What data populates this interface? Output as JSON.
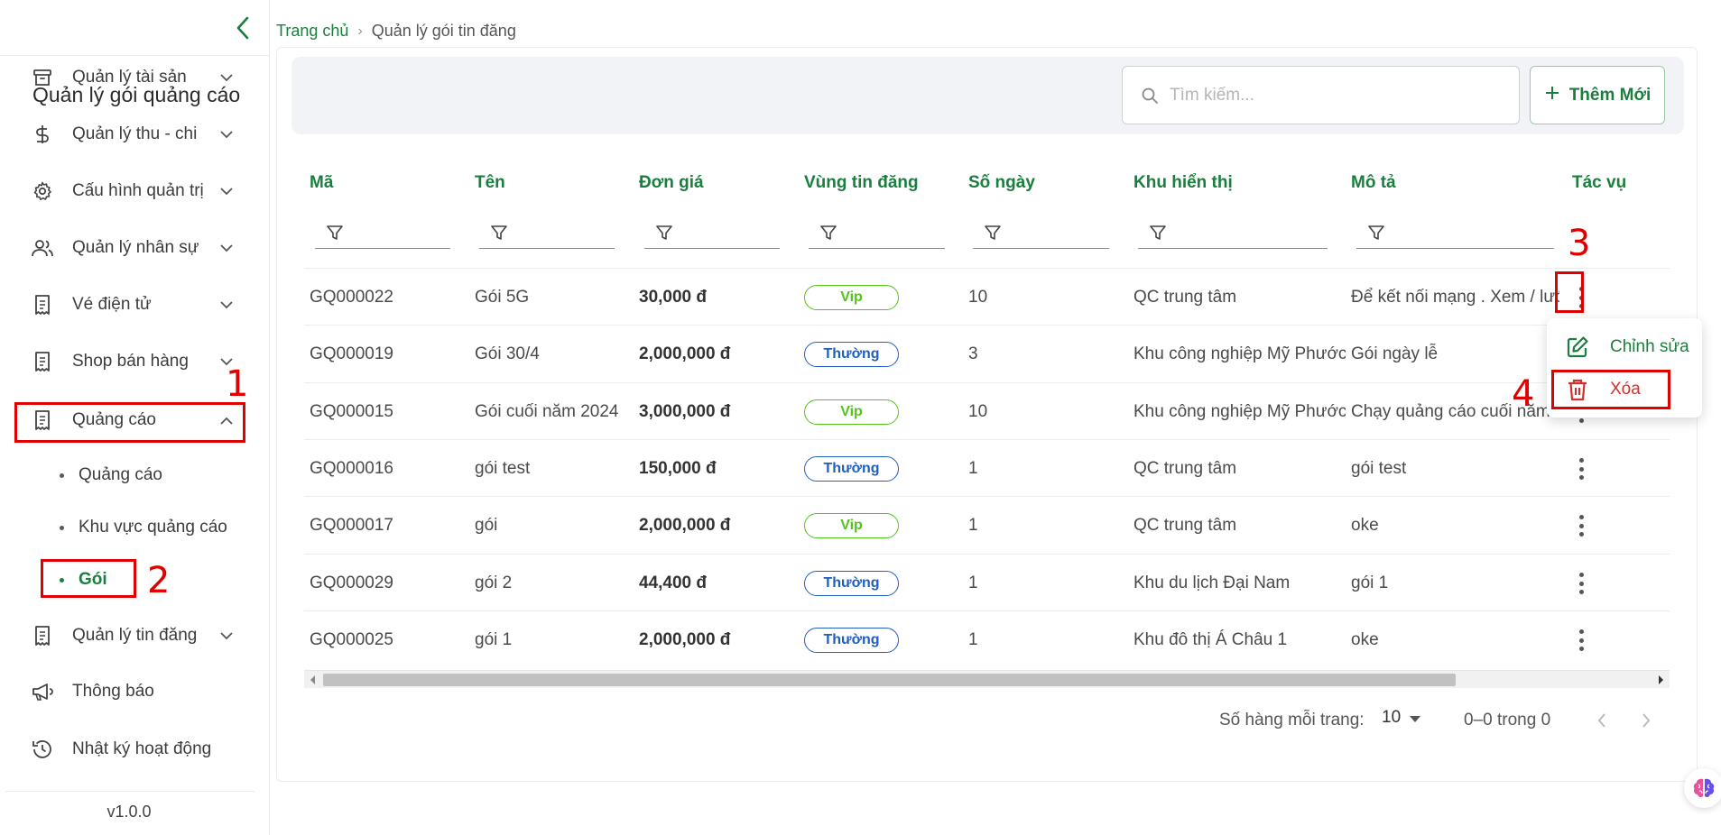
{
  "sidebar": {
    "items": [
      {
        "label": "Quản lý tài sản",
        "icon": "archive-icon"
      },
      {
        "label": "Quản lý thu - chi",
        "icon": "dollar-icon"
      },
      {
        "label": "Cấu hình quản trị",
        "icon": "gear-icon"
      },
      {
        "label": "Quản lý nhân sự",
        "icon": "users-icon"
      },
      {
        "label": "Vé điện tử",
        "icon": "receipt-icon"
      },
      {
        "label": "Shop bán hàng",
        "icon": "receipt-icon"
      },
      {
        "label": "Quảng cáo",
        "icon": "receipt-icon",
        "expanded": true
      },
      {
        "label": "Quản lý tin đăng",
        "icon": "receipt-icon"
      },
      {
        "label": "Thông báo",
        "icon": "megaphone-icon"
      },
      {
        "label": "Nhật ký hoạt động",
        "icon": "history-icon"
      }
    ],
    "subitems": [
      {
        "label": "Quảng cáo",
        "active": false
      },
      {
        "label": "Khu vực quảng cáo",
        "active": false
      },
      {
        "label": "Gói",
        "active": true
      }
    ],
    "version": "v1.0.0"
  },
  "annotations": [
    "1",
    "2",
    "3",
    "4"
  ],
  "breadcrumb": {
    "home": "Trang chủ",
    "current": "Quản lý gói tin đăng"
  },
  "header": {
    "title": "Quản lý gói quảng cáo",
    "search_placeholder": "Tìm kiếm...",
    "search_value": "",
    "add_label": "Thêm Mới"
  },
  "table": {
    "columns": [
      "Mã",
      "Tên",
      "Đơn giá",
      "Vùng tin đăng",
      "Số ngày",
      "Khu hiển thị",
      "Mô tả",
      "Tác vụ"
    ],
    "rows": [
      {
        "ma": "GQ000022",
        "ten": "Gói 5G",
        "don_gia": "30,000 đ",
        "vung": "Vip",
        "so_ngay": "10",
        "khu": "QC trung tâm",
        "mo_ta": "Để kết nối mạng . Xem / lướt"
      },
      {
        "ma": "GQ000019",
        "ten": "Gói 30/4",
        "don_gia": "2,000,000 đ",
        "vung": "Thường",
        "so_ngay": "3",
        "khu": "Khu công nghiệp Mỹ Phước",
        "mo_ta": "Gói ngày lễ"
      },
      {
        "ma": "GQ000015",
        "ten": "Gói cuối năm 2024",
        "don_gia": "3,000,000 đ",
        "vung": "Vip",
        "so_ngay": "10",
        "khu": "Khu công nghiệp Mỹ Phước",
        "mo_ta": "Chạy quảng cáo cuối năm"
      },
      {
        "ma": "GQ000016",
        "ten": "gói test",
        "don_gia": "150,000 đ",
        "vung": "Thường",
        "so_ngay": "1",
        "khu": "QC trung tâm",
        "mo_ta": "gói test"
      },
      {
        "ma": "GQ000017",
        "ten": "gói",
        "don_gia": "2,000,000 đ",
        "vung": "Vip",
        "so_ngay": "1",
        "khu": "QC trung tâm",
        "mo_ta": "oke"
      },
      {
        "ma": "GQ000029",
        "ten": "gói 2",
        "don_gia": "44,400 đ",
        "vung": "Thường",
        "so_ngay": "1",
        "khu": "Khu du lịch Đại Nam",
        "mo_ta": "gói 1"
      },
      {
        "ma": "GQ000025",
        "ten": "gói 1",
        "don_gia": "2,000,000 đ",
        "vung": "Thường",
        "so_ngay": "1",
        "khu": "Khu đô thị Á Châu 1",
        "mo_ta": "oke"
      }
    ]
  },
  "pagination": {
    "rows_label": "Số hàng mỗi trang:",
    "rows_value": "10",
    "range": "0–0 trong 0"
  },
  "menu": {
    "edit_label": "Chỉnh sửa",
    "delete_label": "Xóa"
  },
  "colors": {
    "primary": "#1b7e3e",
    "vip": "#52c41a",
    "normal": "#1f5fbf",
    "annotation": "#e00000"
  }
}
